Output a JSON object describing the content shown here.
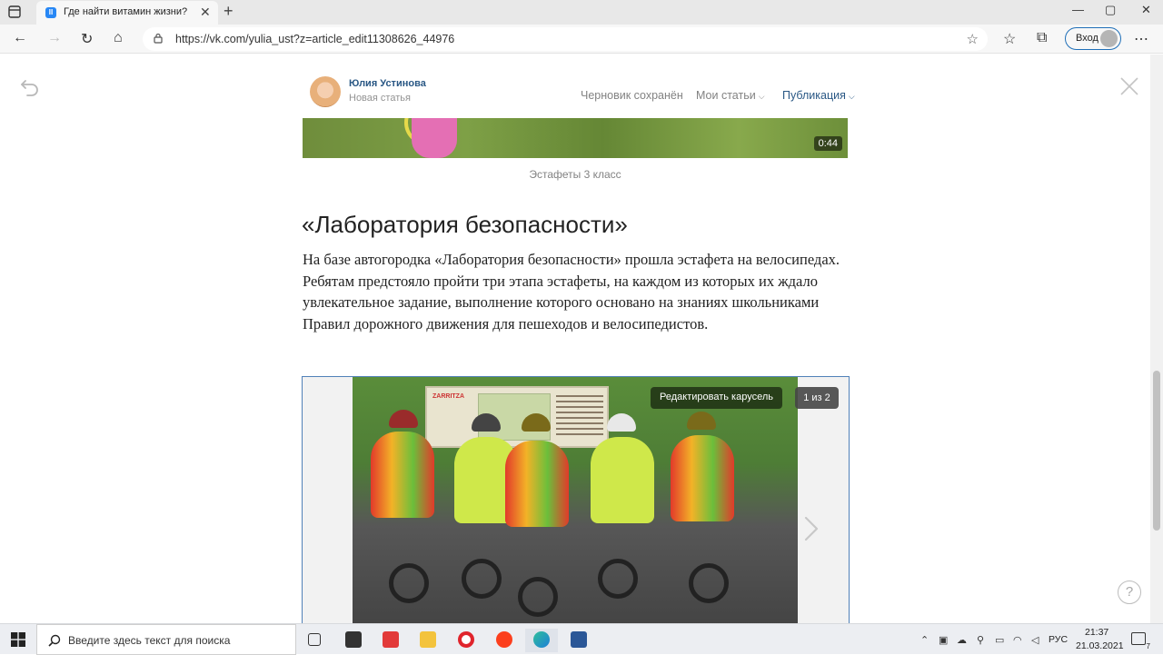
{
  "browser": {
    "tab_title": "Где найти витамин жизни?",
    "url": "https://vk.com/yulia_ust?z=article_edit11308626_44976",
    "signin_label": "Вход"
  },
  "editor": {
    "author_name": "Юлия Устинова",
    "article_status": "Новая статья",
    "draft_saved": "Черновик сохранён",
    "my_articles": "Мои статьи",
    "publish": "Публикация"
  },
  "video": {
    "duration": "0:44",
    "caption": "Эстафеты 3 класс"
  },
  "article": {
    "heading": "«Лаборатория безопасности»",
    "paragraph": "На базе автогородка «Лаборатория безопасности» прошла эстафета на велосипедах. Ребятам предстояло пройти три этапа эстафеты, на каждом из которых их ждало увлекательное задание, выполнение которого основано на знаниях школьниками Правил дорожного движения для пешеходов и велосипедистов."
  },
  "carousel": {
    "edit_label": "Редактировать карусель",
    "counter": "1 из 2",
    "board_brand": "ZARRITZA"
  },
  "taskbar": {
    "search_placeholder": "Введите здесь текст для поиска",
    "language": "РУС",
    "time": "21:37",
    "date": "21.03.2021",
    "notification_count": "7"
  },
  "colors": {
    "vk_blue": "#2a5885",
    "carousel_border": "#5181b8",
    "muted_text": "#828282"
  }
}
